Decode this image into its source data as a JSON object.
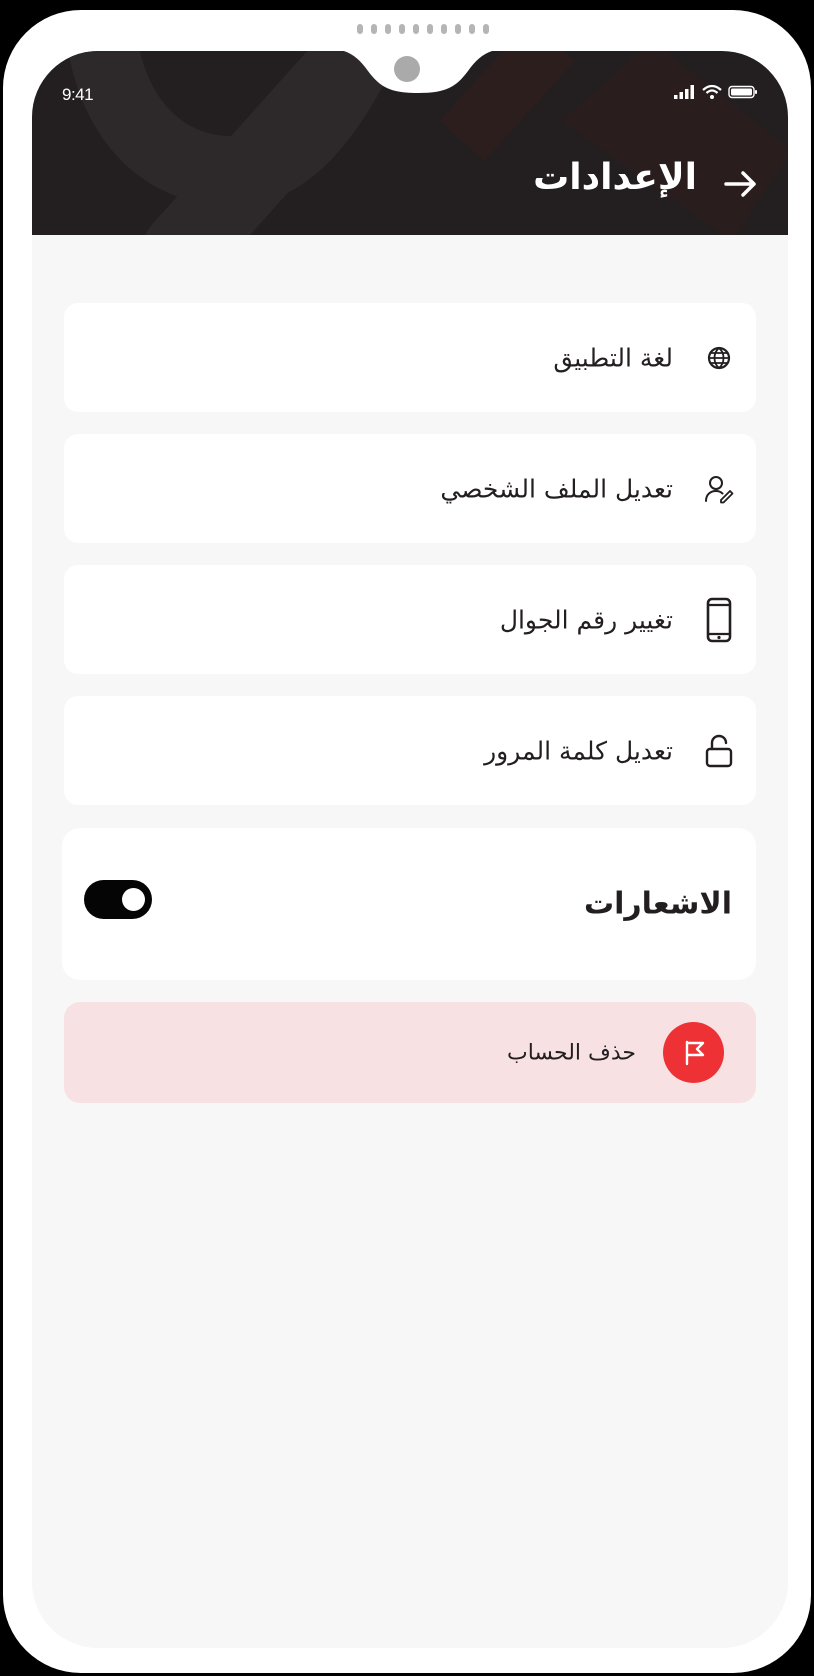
{
  "status_bar": {
    "time": "9:41",
    "signal_icon": "cellular-signal-icon",
    "wifi_icon": "wifi-icon",
    "battery_icon": "battery-icon"
  },
  "header": {
    "title": "الإعدادات",
    "back_icon": "arrow-right-icon"
  },
  "settings": {
    "items": [
      {
        "label": "لغة التطبيق",
        "icon": "globe-icon"
      },
      {
        "label": "تعديل الملف الشخصي",
        "icon": "user-edit-icon"
      },
      {
        "label": "تغيير رقم الجوال",
        "icon": "mobile-phone-icon"
      },
      {
        "label": "تعديل كلمة المرور",
        "icon": "unlock-icon"
      }
    ],
    "notifications": {
      "label": "الاشعارات",
      "enabled": true
    },
    "delete_account": {
      "label": "حذف الحساب",
      "icon": "flag-icon"
    }
  },
  "colors": {
    "header_bg": "#231f20",
    "screen_bg": "#f7f7f7",
    "danger": "#ee3134",
    "danger_bg": "#f7e1e3",
    "toggle_on": "#050505"
  }
}
